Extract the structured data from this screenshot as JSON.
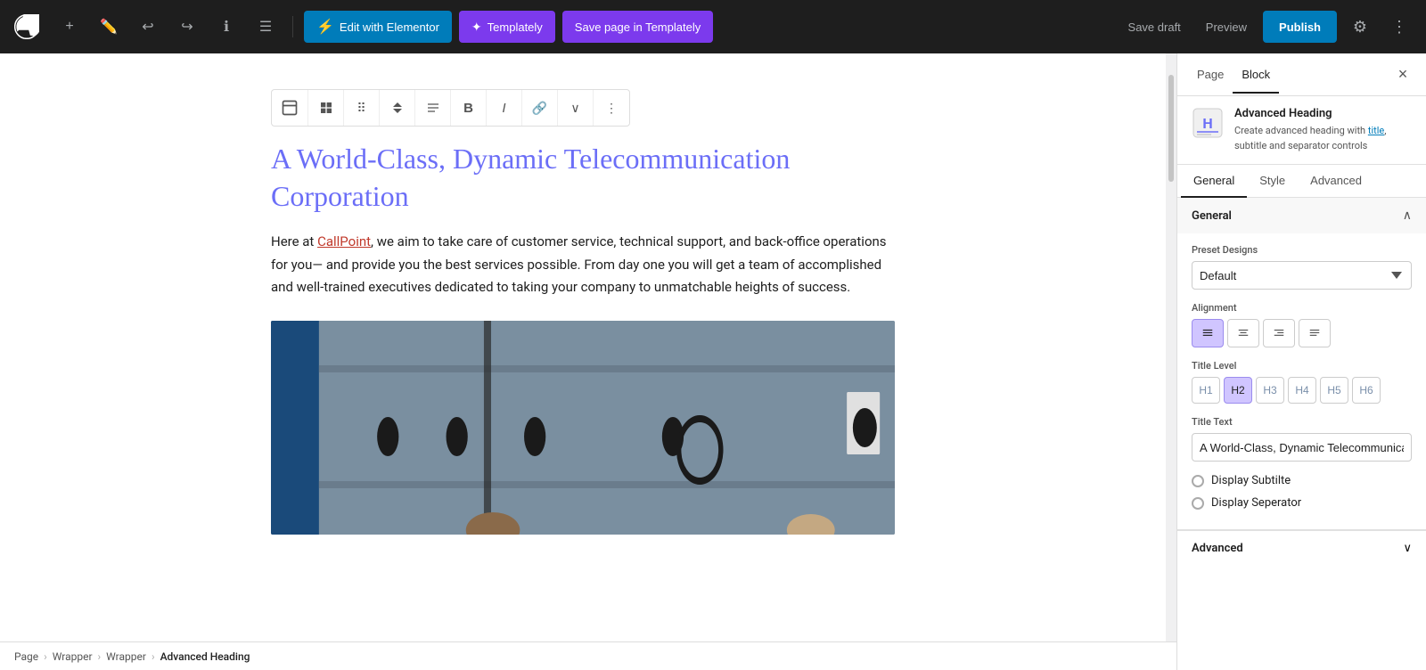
{
  "toolbar": {
    "add_label": "+",
    "edit_elementor_label": "Edit with Elementor",
    "templately_label": "Templately",
    "save_templately_label": "Save page in Templately",
    "save_draft_label": "Save draft",
    "preview_label": "Preview",
    "publish_label": "Publish"
  },
  "sidebar": {
    "tab_page": "Page",
    "tab_block": "Block",
    "close_label": "×",
    "block_icon_text": "↕",
    "block_title": "Advanced Heading",
    "block_description": "Create advanced heading with title, subtitle and separator controls",
    "block_description_link": "title",
    "panel_tabs": [
      "General",
      "Style",
      "Advanced"
    ],
    "active_panel_tab": "General",
    "section_general_title": "General",
    "preset_designs_label": "Preset Designs",
    "preset_designs_value": "Default",
    "alignment_label": "Alignment",
    "alignment_options": [
      "left",
      "center",
      "right",
      "justify"
    ],
    "active_alignment": "center",
    "title_level_label": "Title Level",
    "title_levels": [
      "H1",
      "H2",
      "H3",
      "H4",
      "H5",
      "H6"
    ],
    "active_title_level": "H2",
    "title_text_label": "Title Text",
    "title_text_value": "A World-Class, Dynamic Telecommunica",
    "display_subtitle_label": "Display Subtilte",
    "display_separator_label": "Display Seperator",
    "advanced_section_title": "Advanced"
  },
  "editor": {
    "heading": "A World-Class, Dynamic Telecommunication Corporation",
    "body_text": "Here at CallPoint, we aim to take care of customer service, technical support, and back-office operations for you— and provide you the best services possible. From day one you will get a team of accomplished and well-trained executives dedicated to taking your company to unmatchable heights of success.",
    "link_text": "CallPoint"
  },
  "breadcrumb": {
    "items": [
      "Page",
      "Wrapper",
      "Wrapper",
      "Advanced Heading"
    ]
  }
}
